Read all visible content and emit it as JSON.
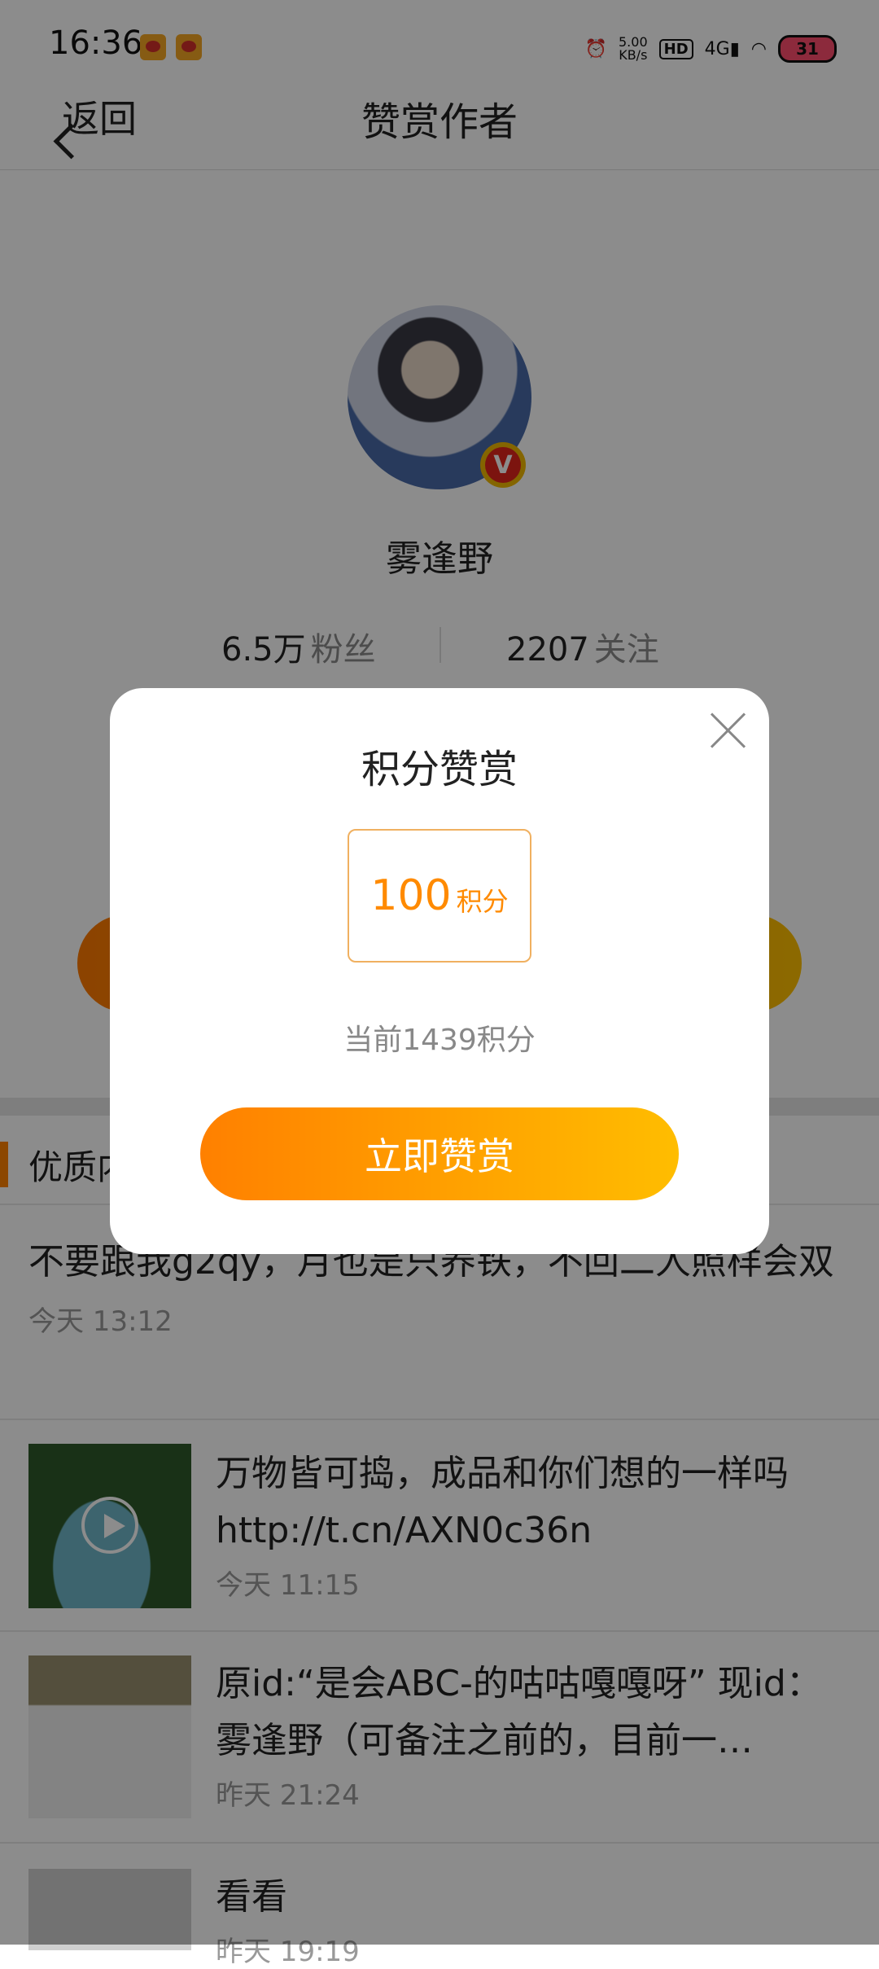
{
  "status_bar": {
    "time": "16:36",
    "net_speed": "5.00",
    "net_unit": "KB/s",
    "hd": "HD",
    "signal": "4G",
    "battery": "31"
  },
  "nav": {
    "back_label": "返回",
    "title": "赞赏作者"
  },
  "profile": {
    "name": "雾逢野",
    "verify_badge": "V",
    "fans_count": "6.5万",
    "fans_label": "粉丝",
    "follow_count": "2207",
    "follow_label": "关注"
  },
  "section": {
    "title": "优质内容"
  },
  "posts": [
    {
      "text": "不要跟我g2qy，月也是只养铁，不回二人照样会双",
      "time": "今天 13:12"
    },
    {
      "text": "万物皆可捣，成品和你们想的一样吗 http://t.cn/AXN0c36n",
      "time": "今天 11:15"
    },
    {
      "text": "原id:“是会ABC-的咕咕嘎嘎呀” 现id：雾逢野（可备注之前的，目前一…",
      "time": "昨天 21:24"
    },
    {
      "text": "看看",
      "time": "昨天 19:19"
    }
  ],
  "modal": {
    "title": "积分赞赏",
    "amount": "100",
    "amount_unit": "积分",
    "balance": "当前1439积分",
    "confirm_label": "立即赞赏"
  }
}
